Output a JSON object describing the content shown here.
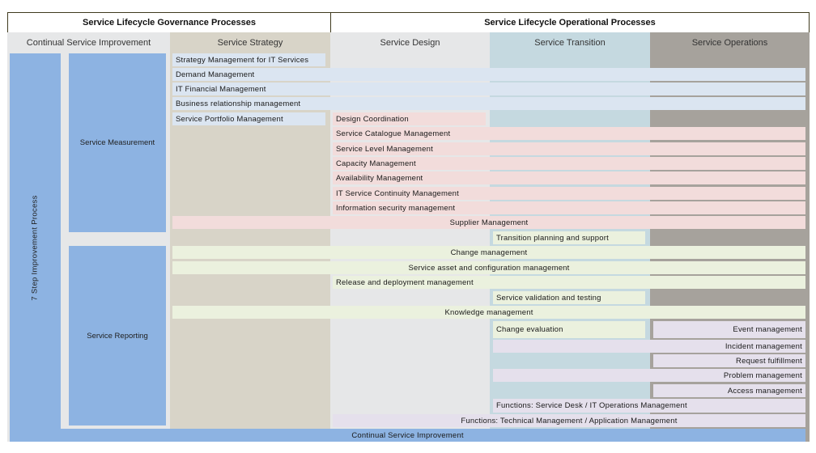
{
  "header": {
    "governance": "Service Lifecycle Governance Processes",
    "operational": "Service Lifecycle Operational Processes"
  },
  "columns": [
    {
      "label": "Continual Service Improvement"
    },
    {
      "label": "Service Strategy"
    },
    {
      "label": "Service Design"
    },
    {
      "label": "Service Transition"
    },
    {
      "label": "Service Operations"
    }
  ],
  "csi": {
    "seven_step": "7 Step Improvement Process",
    "service_measurement": "Service Measurement",
    "service_reporting": "Service Reporting",
    "bottom_bar": "Continual Service Improvement"
  },
  "processes": [
    "Strategy Management for IT Services",
    "Demand Management",
    "IT Financial Management",
    "Business relationship management",
    "Service Portfolio Management",
    "Design Coordination",
    "Service Catalogue Management",
    "Service Level Management",
    "Capacity Management",
    "Availability Management",
    "IT Service Continuity Management",
    "Information security management",
    "Supplier Management",
    "Transition planning and support",
    "Change management",
    "Service asset and configuration management",
    "Release and deployment management",
    "Service validation and testing",
    "Knowledge management",
    "Change evaluation",
    "Event management",
    "Incident management",
    "Request fulfillment",
    "Problem management",
    "Access management",
    "Functions: Service Desk / IT Operations Management",
    "Functions: Technical Management / Application Management"
  ],
  "colors": {
    "csi_blue": "#8db3e2",
    "strategy_row": "#dbe5f1",
    "design_row": "#f2dcdb",
    "transition_row": "#ebf1de",
    "operations_row": "#e5e0ec",
    "csi_column": "#e6e7e8",
    "strategy_column": "#d8d4c8",
    "design_column": "#e6e7e8",
    "transition_column": "#c5d9e0",
    "operations_column": "#a6a29c"
  }
}
